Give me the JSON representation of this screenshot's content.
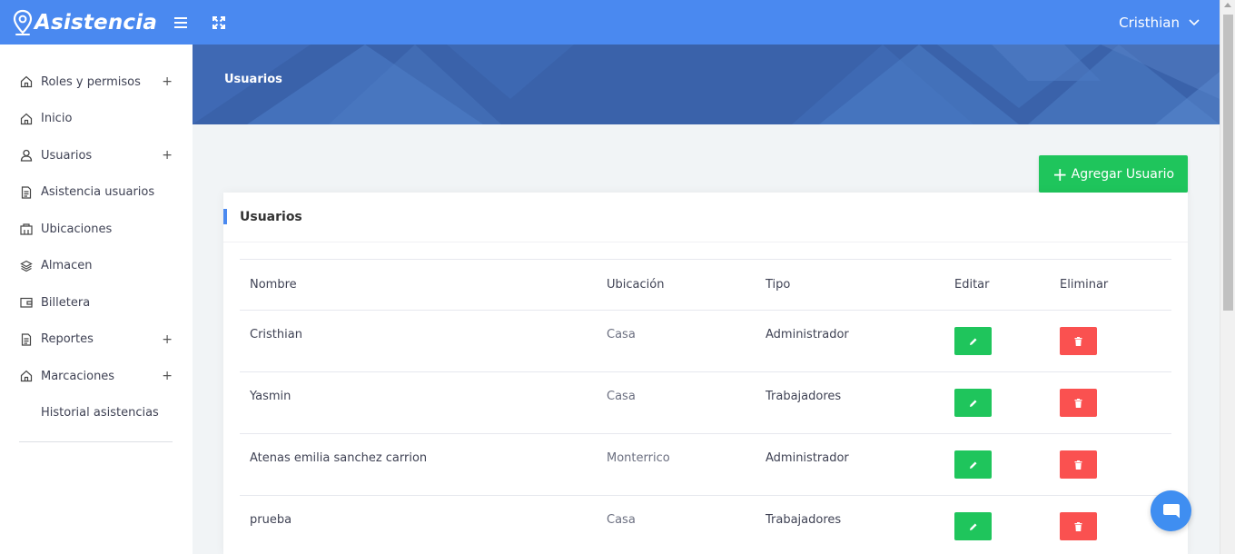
{
  "app": {
    "brand": "Asistencia",
    "user_name": "Cristhian"
  },
  "sidebar": {
    "items": [
      {
        "label": "Roles y permisos",
        "icon": "home-icon",
        "expandable": true
      },
      {
        "label": "Inicio",
        "icon": "home-icon",
        "expandable": false
      },
      {
        "label": "Usuarios",
        "icon": "user-icon",
        "expandable": true
      },
      {
        "label": "Asistencia usuarios",
        "icon": "document-icon",
        "expandable": false
      },
      {
        "label": "Ubicaciones",
        "icon": "building-icon",
        "expandable": false
      },
      {
        "label": "Almacen",
        "icon": "layers-icon",
        "expandable": false
      },
      {
        "label": "Billetera",
        "icon": "wallet-icon",
        "expandable": false
      },
      {
        "label": "Reportes",
        "icon": "document-icon",
        "expandable": true
      },
      {
        "label": "Marcaciones",
        "icon": "home-icon",
        "expandable": true
      },
      {
        "label": "Historial asistencias",
        "icon": "",
        "expandable": false
      }
    ]
  },
  "banner": {
    "title": "Usuarios"
  },
  "actions": {
    "add_label": "Agregar Usuario"
  },
  "card": {
    "title": "Usuarios"
  },
  "table": {
    "headers": [
      "Nombre",
      "Ubicación",
      "Tipo",
      "Editar",
      "Eliminar"
    ],
    "rows": [
      {
        "nombre": "Cristhian",
        "ubicacion": "Casa",
        "tipo": "Administrador"
      },
      {
        "nombre": "Yasmin",
        "ubicacion": "Casa",
        "tipo": "Trabajadores"
      },
      {
        "nombre": "Atenas emilia sanchez carrion",
        "ubicacion": "Monterrico",
        "tipo": "Administrador"
      },
      {
        "nombre": "prueba",
        "ubicacion": "Casa",
        "tipo": "Trabajadores"
      }
    ]
  },
  "colors": {
    "topbar": "#4a89f0",
    "banner": "#3d67b0",
    "success": "#1fc55c",
    "danger": "#fa5150",
    "accent": "#4a89f0"
  }
}
